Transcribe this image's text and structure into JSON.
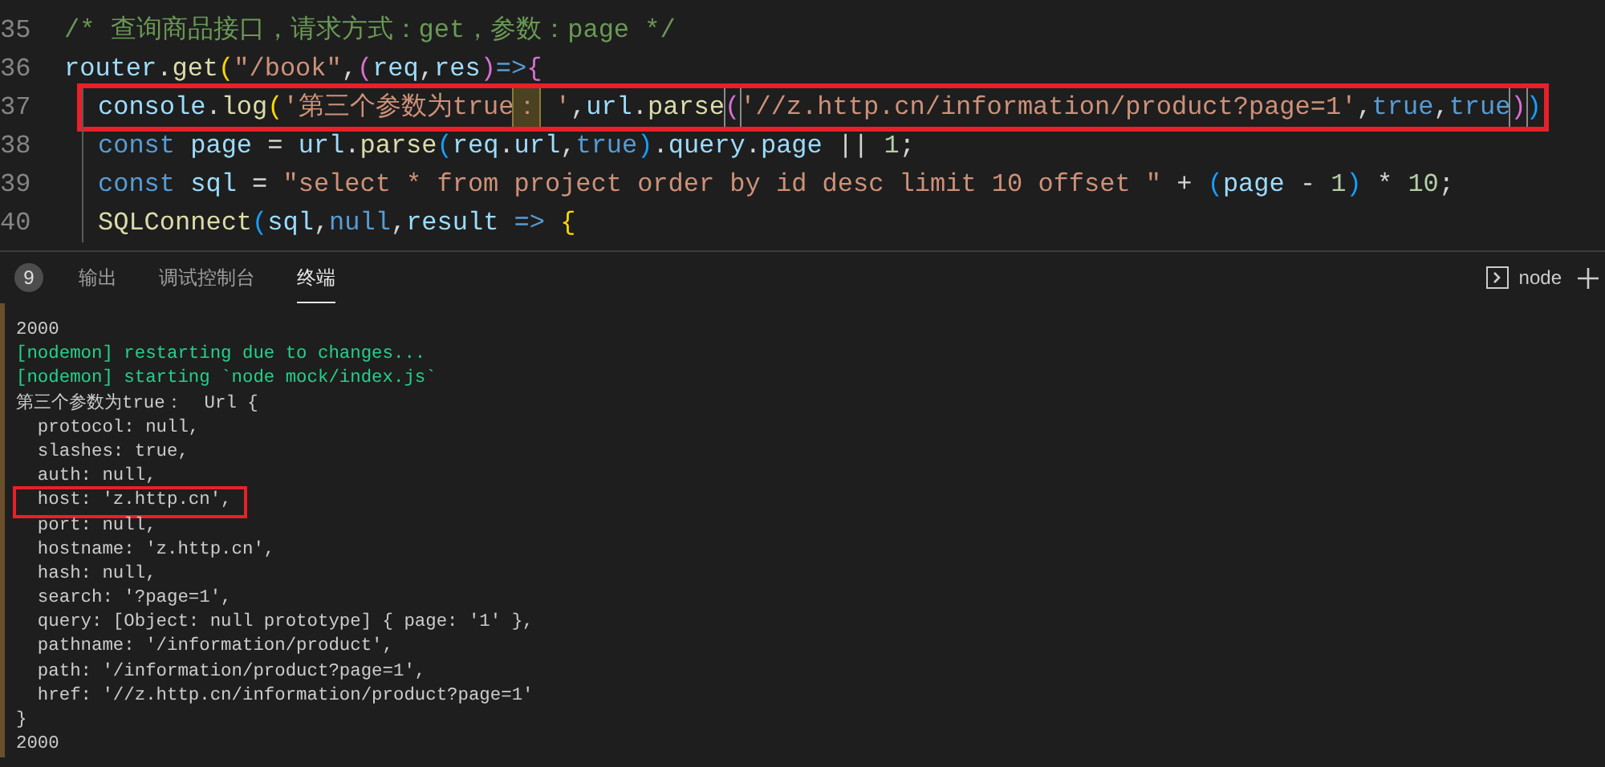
{
  "editor": {
    "lines": [
      {
        "number": "35",
        "highlighted": false,
        "tokens": [
          {
            "kind": "comment",
            "text": "/* 查询商品接口，请求方式：get，参数：page */"
          }
        ]
      },
      {
        "number": "36",
        "highlighted": false,
        "tokens": [
          {
            "kind": "var",
            "text": "router"
          },
          {
            "kind": "punct",
            "text": "."
          },
          {
            "kind": "func",
            "text": "get"
          },
          {
            "kind": "gold",
            "text": "("
          },
          {
            "kind": "string",
            "text": "\"/book\""
          },
          {
            "kind": "punct",
            "text": ","
          },
          {
            "kind": "purple",
            "text": "("
          },
          {
            "kind": "var",
            "text": "req"
          },
          {
            "kind": "punct",
            "text": ","
          },
          {
            "kind": "var",
            "text": "res"
          },
          {
            "kind": "purple",
            "text": ")"
          },
          {
            "kind": "keyword",
            "text": "=>"
          },
          {
            "kind": "purple",
            "text": "{"
          }
        ]
      },
      {
        "number": "37",
        "highlighted": true,
        "indented": true,
        "tokens": [
          {
            "kind": "var",
            "text": "console"
          },
          {
            "kind": "punct",
            "text": "."
          },
          {
            "kind": "func",
            "text": "log"
          },
          {
            "kind": "gold",
            "text": "("
          },
          {
            "kind": "string",
            "text": "'第三个参数为true"
          },
          {
            "kind": "string-match",
            "text": "："
          },
          {
            "kind": "string",
            "text": " '"
          },
          {
            "kind": "punct",
            "text": ","
          },
          {
            "kind": "var",
            "text": "url"
          },
          {
            "kind": "punct",
            "text": "."
          },
          {
            "kind": "func",
            "text": "parse"
          },
          {
            "kind": "purple-match",
            "text": "("
          },
          {
            "kind": "string",
            "text": "'//z.http.cn/information/product?page=1'"
          },
          {
            "kind": "punct",
            "text": ","
          },
          {
            "kind": "keyword",
            "text": "true"
          },
          {
            "kind": "punct",
            "text": ","
          },
          {
            "kind": "keyword",
            "text": "true"
          },
          {
            "kind": "purple-match",
            "text": ")"
          },
          {
            "kind": "blue",
            "text": ")"
          }
        ]
      },
      {
        "number": "38",
        "highlighted": false,
        "indented": true,
        "tokens": [
          {
            "kind": "keyword",
            "text": "const "
          },
          {
            "kind": "var",
            "text": "page"
          },
          {
            "kind": "punct",
            "text": " = "
          },
          {
            "kind": "var",
            "text": "url"
          },
          {
            "kind": "punct",
            "text": "."
          },
          {
            "kind": "func",
            "text": "parse"
          },
          {
            "kind": "blue",
            "text": "("
          },
          {
            "kind": "var",
            "text": "req"
          },
          {
            "kind": "punct",
            "text": "."
          },
          {
            "kind": "var",
            "text": "url"
          },
          {
            "kind": "punct",
            "text": ","
          },
          {
            "kind": "keyword",
            "text": "true"
          },
          {
            "kind": "blue",
            "text": ")"
          },
          {
            "kind": "punct",
            "text": "."
          },
          {
            "kind": "var",
            "text": "query"
          },
          {
            "kind": "punct",
            "text": "."
          },
          {
            "kind": "var",
            "text": "page"
          },
          {
            "kind": "punct",
            "text": " || "
          },
          {
            "kind": "number",
            "text": "1"
          },
          {
            "kind": "punct",
            "text": ";"
          }
        ]
      },
      {
        "number": "39",
        "highlighted": false,
        "indented": true,
        "tokens": [
          {
            "kind": "keyword",
            "text": "const "
          },
          {
            "kind": "var",
            "text": "sql"
          },
          {
            "kind": "punct",
            "text": " = "
          },
          {
            "kind": "string",
            "text": "\"select * from project order by id desc limit 10 offset \""
          },
          {
            "kind": "punct",
            "text": " + "
          },
          {
            "kind": "blue",
            "text": "("
          },
          {
            "kind": "var",
            "text": "page"
          },
          {
            "kind": "punct",
            "text": " - "
          },
          {
            "kind": "number",
            "text": "1"
          },
          {
            "kind": "blue",
            "text": ")"
          },
          {
            "kind": "punct",
            "text": " * "
          },
          {
            "kind": "number",
            "text": "10"
          },
          {
            "kind": "punct",
            "text": ";"
          }
        ]
      },
      {
        "number": "40",
        "highlighted": false,
        "indented": true,
        "tokens": [
          {
            "kind": "func",
            "text": "SQLConnect"
          },
          {
            "kind": "blue",
            "text": "("
          },
          {
            "kind": "var",
            "text": "sql"
          },
          {
            "kind": "punct",
            "text": ","
          },
          {
            "kind": "keyword",
            "text": "null"
          },
          {
            "kind": "punct",
            "text": ","
          },
          {
            "kind": "var",
            "text": "result"
          },
          {
            "kind": "keyword",
            "text": " => "
          },
          {
            "kind": "gold",
            "text": "{"
          }
        ]
      }
    ]
  },
  "panel": {
    "badge": "9",
    "tabs": [
      {
        "label": "输出",
        "selected": false
      },
      {
        "label": "调试控制台",
        "selected": false
      },
      {
        "label": "终端",
        "selected": true
      }
    ],
    "terminal_name": "node"
  },
  "terminal": {
    "lines": [
      {
        "kind": "plain",
        "text": "2000",
        "highlighted": false
      },
      {
        "kind": "nodemon",
        "text": "[nodemon] restarting due to changes...",
        "highlighted": false
      },
      {
        "kind": "nodemon",
        "text": "[nodemon] starting `node mock/index.js`",
        "highlighted": false
      },
      {
        "kind": "plain",
        "text": "第三个参数为true：  Url {",
        "highlighted": false
      },
      {
        "kind": "plain",
        "text": "  protocol: null,",
        "highlighted": false
      },
      {
        "kind": "plain",
        "text": "  slashes: true,",
        "highlighted": false
      },
      {
        "kind": "plain",
        "text": "  auth: null,",
        "highlighted": false
      },
      {
        "kind": "plain",
        "text": "  host: 'z.http.cn',",
        "highlighted": true
      },
      {
        "kind": "plain",
        "text": "  port: null,",
        "highlighted": false
      },
      {
        "kind": "plain",
        "text": "  hostname: 'z.http.cn',",
        "highlighted": false
      },
      {
        "kind": "plain",
        "text": "  hash: null,",
        "highlighted": false
      },
      {
        "kind": "plain",
        "text": "  search: '?page=1',",
        "highlighted": false
      },
      {
        "kind": "plain",
        "text": "  query: [Object: null prototype] { page: '1' },",
        "highlighted": false
      },
      {
        "kind": "plain",
        "text": "  pathname: '/information/product',",
        "highlighted": false
      },
      {
        "kind": "plain",
        "text": "  path: '/information/product?page=1',",
        "highlighted": false
      },
      {
        "kind": "plain",
        "text": "  href: '//z.http.cn/information/product?page=1'",
        "highlighted": false
      },
      {
        "kind": "plain",
        "text": "}",
        "highlighted": false
      },
      {
        "kind": "plain",
        "text": "2000",
        "highlighted": false
      }
    ]
  }
}
